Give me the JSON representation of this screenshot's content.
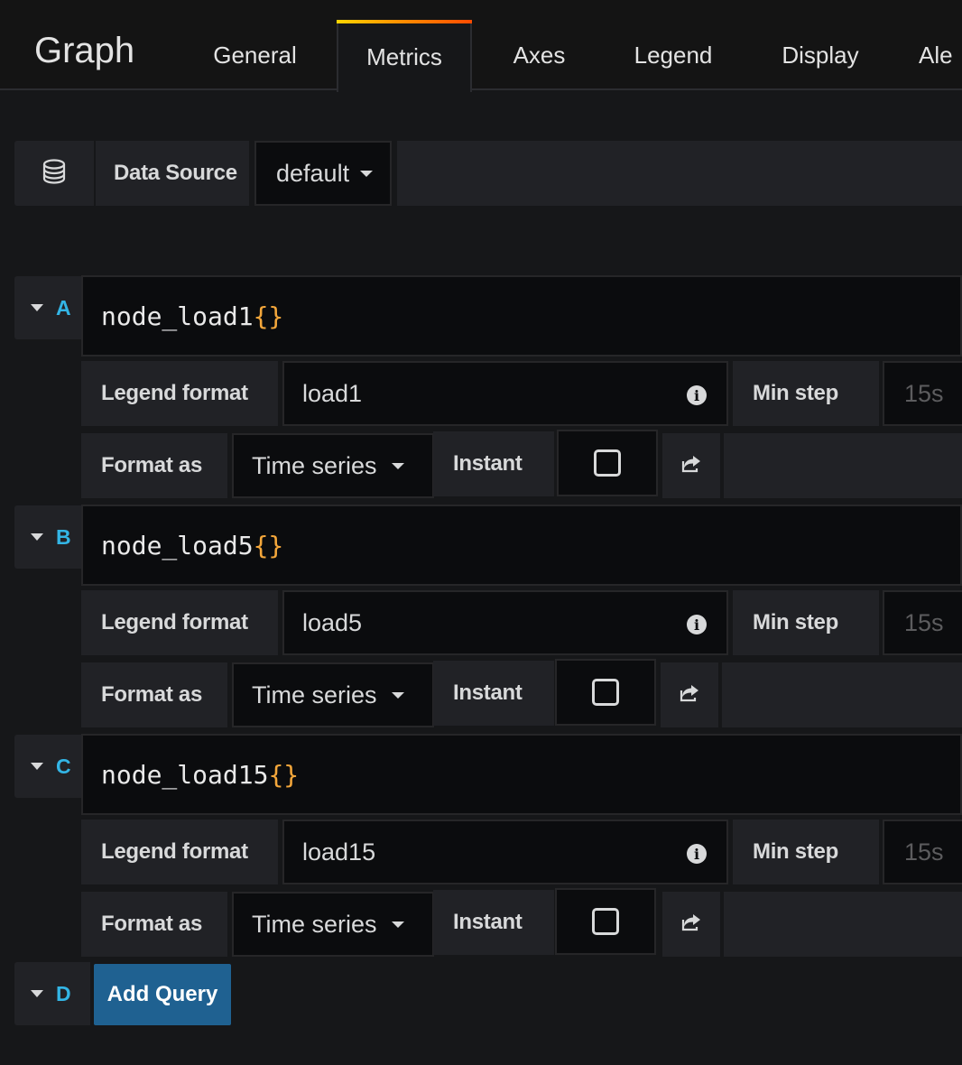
{
  "header": {
    "title": "Graph",
    "tabs": [
      {
        "label": "General"
      },
      {
        "label": "Metrics"
      },
      {
        "label": "Axes"
      },
      {
        "label": "Legend"
      },
      {
        "label": "Display"
      },
      {
        "label": "Ale"
      }
    ],
    "active_tab": "Metrics"
  },
  "datasource": {
    "label": "Data Source",
    "value": "default",
    "icon": "database-icon"
  },
  "queries": [
    {
      "ref": "A",
      "expr": "node_load1",
      "legend_label": "Legend format",
      "legend_value": "load1",
      "min_step_label": "Min step",
      "min_step_placeholder": "15s",
      "format_label": "Format as",
      "format_value": "Time series",
      "instant_label": "Instant"
    },
    {
      "ref": "B",
      "expr": "node_load5",
      "legend_label": "Legend format",
      "legend_value": "load5",
      "min_step_label": "Min step",
      "min_step_placeholder": "15s",
      "format_label": "Format as",
      "format_value": "Time series",
      "instant_label": "Instant"
    },
    {
      "ref": "C",
      "expr": "node_load15",
      "legend_label": "Legend format",
      "legend_value": "load15",
      "min_step_label": "Min step",
      "min_step_placeholder": "15s",
      "format_label": "Format as",
      "format_value": "Time series",
      "instant_label": "Instant"
    }
  ],
  "add_row": {
    "ref": "D",
    "button_label": "Add Query"
  },
  "colors": {
    "ref_letter": "#33b5e5",
    "brace": "#f4a73b",
    "add_button": "#1f6191",
    "active_tab_accent": "#ff8b00"
  }
}
